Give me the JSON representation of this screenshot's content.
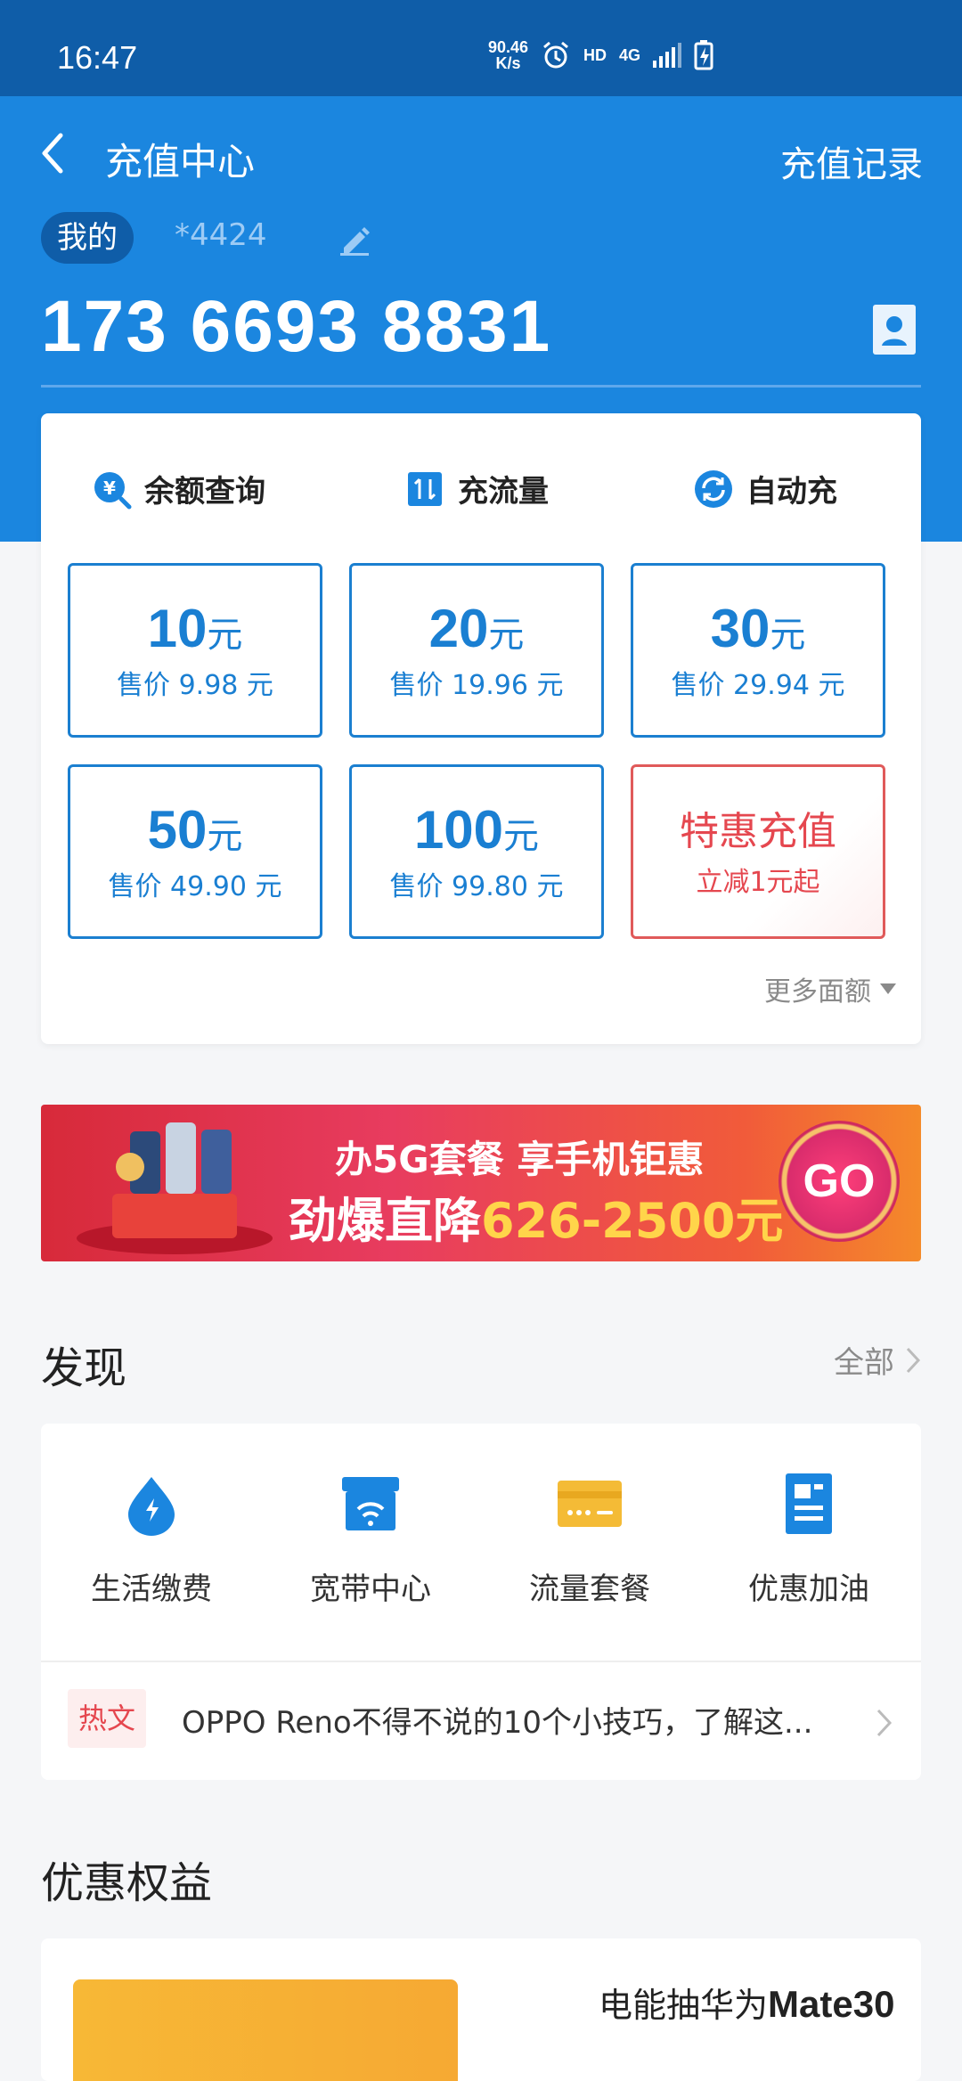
{
  "status": {
    "time": "16:47",
    "speed_value": "90.46",
    "speed_unit": "K/s",
    "hd": "HD",
    "network": "4G"
  },
  "nav": {
    "title": "充值中心",
    "records": "充值记录"
  },
  "account": {
    "owner": "我的",
    "mask": "*4424",
    "phone": "173 6693 8831"
  },
  "quick": [
    {
      "label": "余额查询",
      "icon": "balance-search-icon"
    },
    {
      "label": "充流量",
      "icon": "data-transfer-icon"
    },
    {
      "label": "自动充",
      "icon": "auto-recharge-icon"
    }
  ],
  "recharge": [
    {
      "amount": "10",
      "unit": "元",
      "price": "售价 9.98 元"
    },
    {
      "amount": "20",
      "unit": "元",
      "price": "售价 19.96 元"
    },
    {
      "amount": "30",
      "unit": "元",
      "price": "售价 29.94 元"
    },
    {
      "amount": "50",
      "unit": "元",
      "price": "售价 49.90 元"
    },
    {
      "amount": "100",
      "unit": "元",
      "price": "售价 99.80 元"
    }
  ],
  "special": {
    "title": "特惠充值",
    "subtitle": "立减1元起"
  },
  "more_amounts": "更多面额",
  "banner": {
    "line1": "办5G套餐 享手机钜惠",
    "line2_prefix": "劲爆直降",
    "line2_range": "626-2500元",
    "go": "GO"
  },
  "discover": {
    "title": "发现",
    "all": "全部",
    "services": [
      {
        "label": "生活缴费",
        "icon": "utility-payment-icon"
      },
      {
        "label": "宽带中心",
        "icon": "broadband-icon"
      },
      {
        "label": "流量套餐",
        "icon": "data-plan-icon"
      },
      {
        "label": "优惠加油",
        "icon": "fuel-discount-icon"
      }
    ],
    "hot_tag": "热文",
    "hot_news": "OPPO Reno不得不说的10个小技巧，了解这..."
  },
  "benefits": {
    "title": "优惠权益",
    "promo_prefix": "电能抽华为",
    "promo_bold": "Mate30"
  },
  "colors": {
    "primary": "#1b86df",
    "statusbar": "#0f5da8",
    "accent_red": "#e5474f",
    "option_blue": "#1a7fd2"
  }
}
